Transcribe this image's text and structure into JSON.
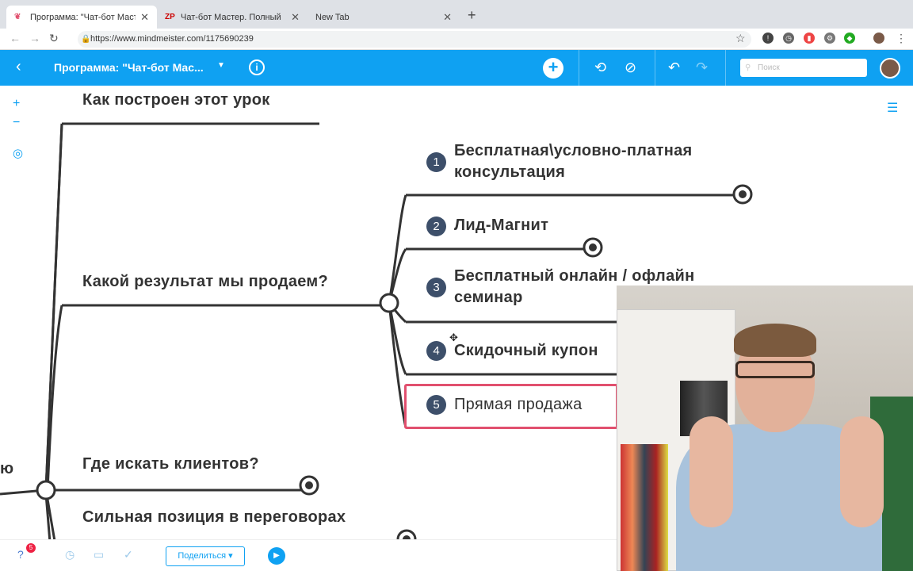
{
  "browser": {
    "tabs": [
      {
        "favicon": "mindmeister-icon",
        "title": "Программа: \"Чат-бот Мастер",
        "active": true
      },
      {
        "favicon": "ZP",
        "title": "Чат-бот Мастер. Полный",
        "active": false
      },
      {
        "favicon": "",
        "title": "New Tab",
        "active": false
      }
    ],
    "url": "https://www.mindmeister.com/1175690239"
  },
  "app": {
    "map_title": "Программа:  \"Чат-бот Мас...",
    "search_placeholder": "Поиск",
    "accent_color": "#0fa1f2"
  },
  "map": {
    "nodes": {
      "lesson": "Как построен этот урок",
      "result": "Какой результат мы продаем?",
      "clients": "Где искать клиентов?",
      "position": "Сильная позиция в переговорах",
      "cut_left": "ю"
    },
    "subtopics": [
      {
        "num": "1",
        "line1": "Бесплатная\\условно-платная",
        "line2": "консультация"
      },
      {
        "num": "2",
        "line1": "Лид-Магнит",
        "line2": ""
      },
      {
        "num": "3",
        "line1": "Бесплатный онлайн / офлайн",
        "line2": "семинар"
      },
      {
        "num": "4",
        "line1": "Скидочный купон",
        "line2": ""
      },
      {
        "num": "5",
        "line1": "Прямая продажа",
        "line2": ""
      }
    ]
  },
  "bottom": {
    "share_label": "Поделиться ▾",
    "notif_count": "5"
  }
}
